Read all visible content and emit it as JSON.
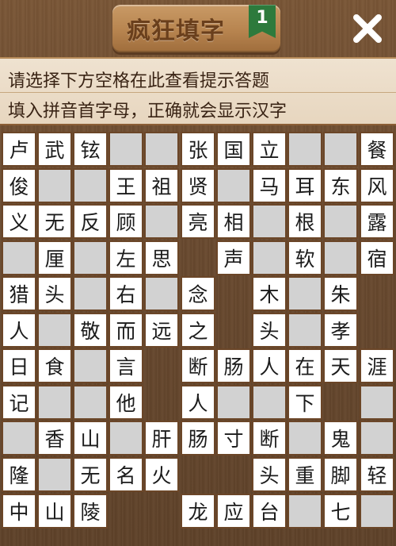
{
  "header": {
    "title": "疯狂填字",
    "level": "1",
    "close_icon": "close-icon"
  },
  "hints": {
    "line1": "请选择下方空格在此查看提示答题",
    "line2": "填入拼音首字母，正确就会显示汉字"
  },
  "grid": {
    "rows": [
      [
        "卢",
        "武",
        "铉",
        "_",
        "_",
        "张",
        "国",
        "立",
        "_",
        "_",
        "餐"
      ],
      [
        "俊",
        "_",
        "_",
        "王",
        "祖",
        "贤",
        "_",
        "马",
        "耳",
        "东",
        "风"
      ],
      [
        "义",
        "无",
        "反",
        "顾",
        "_",
        "亮",
        "相",
        "_",
        "根",
        "_",
        "露"
      ],
      [
        "_",
        "厘",
        "_",
        "左",
        "思",
        "_",
        "声",
        "_",
        "软",
        "_",
        "宿"
      ],
      [
        "猎",
        "头",
        "_",
        "右",
        "_",
        "念",
        "_",
        "木",
        "_",
        "朱",
        "_"
      ],
      [
        "人",
        "_",
        "敬",
        "而",
        "远",
        "之",
        "_",
        "头",
        "_",
        "孝",
        "_"
      ],
      [
        "日",
        "食",
        "_",
        "言",
        "_",
        "断",
        "肠",
        "人",
        "在",
        "天",
        "涯"
      ],
      [
        "记",
        "_",
        "_",
        "他",
        "_",
        "人",
        "_",
        "_",
        "下",
        "_",
        "_"
      ],
      [
        "_",
        "香",
        "山",
        "_",
        "肝",
        "肠",
        "寸",
        "断",
        "_",
        "鬼",
        "_"
      ],
      [
        "隆",
        "_",
        "无",
        "名",
        "火",
        "_",
        "_",
        "头",
        "重",
        "脚",
        "轻"
      ],
      [
        "中",
        "山",
        "陵",
        "_",
        "_",
        "龙",
        "应",
        "台",
        "_",
        "七",
        "_"
      ]
    ],
    "cell_types": [
      [
        "f",
        "f",
        "f",
        "b",
        "b",
        "f",
        "f",
        "f",
        "b",
        "b",
        "f"
      ],
      [
        "f",
        "b",
        "b",
        "f",
        "f",
        "f",
        "b",
        "f",
        "f",
        "f",
        "f"
      ],
      [
        "f",
        "f",
        "f",
        "f",
        "b",
        "f",
        "f",
        "b",
        "f",
        "b",
        "f"
      ],
      [
        "b",
        "f",
        "b",
        "f",
        "f",
        "w",
        "f",
        "b",
        "f",
        "b",
        "f"
      ],
      [
        "f",
        "f",
        "b",
        "f",
        "b",
        "f",
        "w",
        "f",
        "b",
        "f",
        "w"
      ],
      [
        "f",
        "b",
        "f",
        "f",
        "f",
        "f",
        "w",
        "f",
        "b",
        "f",
        "w"
      ],
      [
        "f",
        "f",
        "b",
        "f",
        "w",
        "f",
        "f",
        "f",
        "f",
        "f",
        "f"
      ],
      [
        "f",
        "b",
        "b",
        "f",
        "w",
        "f",
        "b",
        "b",
        "f",
        "w",
        "b"
      ],
      [
        "b",
        "f",
        "f",
        "b",
        "f",
        "f",
        "f",
        "f",
        "b",
        "f",
        "b"
      ],
      [
        "f",
        "b",
        "f",
        "f",
        "f",
        "w",
        "w",
        "f",
        "f",
        "f",
        "f"
      ],
      [
        "f",
        "f",
        "f",
        "w",
        "w",
        "f",
        "f",
        "f",
        "b",
        "f",
        "b"
      ]
    ]
  }
}
